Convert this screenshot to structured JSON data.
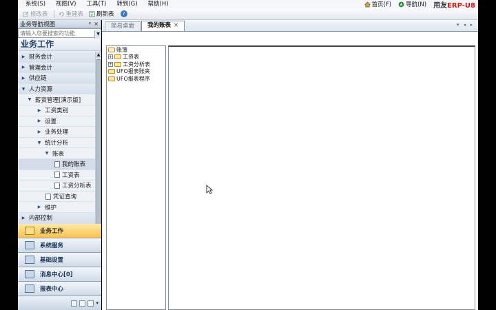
{
  "menubar": {
    "items": [
      "系统(S)",
      "视图(V)",
      "工具(T)",
      "转到(G)",
      "帮助(H)"
    ],
    "home": "首页(F)",
    "nav": "导航(N)",
    "logo_a": "用友",
    "logo_b": "ERP-U8"
  },
  "toolbar": {
    "edit_table": "修改表",
    "rebuild_table": "重建表",
    "refresh_table": "刷新表"
  },
  "leftpanel": {
    "title": "业务导航视图",
    "pin": "ᵖ",
    "close": "×",
    "search_placeholder": "请输入您要搜索的功能",
    "section_title": "业务工作",
    "nav_items": [
      {
        "label": "财务会计"
      },
      {
        "label": "管理会计"
      },
      {
        "label": "供应链"
      },
      {
        "label": "人力资源"
      },
      {
        "label": "薪资管理[演示版]"
      },
      {
        "label": "工资类别"
      },
      {
        "label": "设置"
      },
      {
        "label": "业务处理"
      },
      {
        "label": "统计分析"
      },
      {
        "label": "账表"
      },
      {
        "label": "我的账表"
      },
      {
        "label": "工资表"
      },
      {
        "label": "工资分析表"
      },
      {
        "label": "凭证查询"
      },
      {
        "label": "维护"
      },
      {
        "label": "内部控制"
      }
    ],
    "big_buttons": [
      "业务工作",
      "系统服务",
      "基础设置",
      "消息中心[0]",
      "报表中心"
    ]
  },
  "content": {
    "tabs": [
      "简易桌面",
      "我的账表"
    ],
    "tab_close": "×",
    "tab_ctrls": "▾ ◂ ▸",
    "tree": [
      {
        "label": "账簿"
      },
      {
        "label": "工资表"
      },
      {
        "label": "工资分析表"
      },
      {
        "label": "UFO报表账夹"
      },
      {
        "label": "UFO报表程序"
      }
    ]
  },
  "colors": {
    "accent": "#f7c24c",
    "nav_bg": "#e8eef5",
    "logo_red": "#d01515"
  }
}
